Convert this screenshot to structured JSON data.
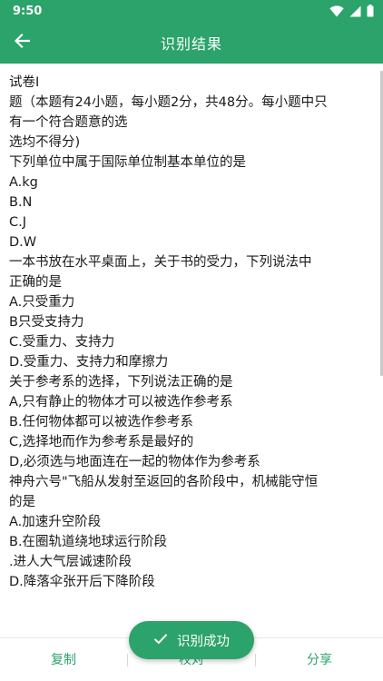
{
  "status_bar": {
    "time": "9:50"
  },
  "app_bar": {
    "title": "识别结果"
  },
  "content": {
    "lines": [
      "试卷I",
      "题（本题有24小题，每小题2分，共48分。每小题中只",
      "有一个符合题意的选",
      "选均不得分)",
      "下列单位中属于国际单位制基本单位的是",
      "A.kg",
      "B.N",
      "C.J",
      "D.W",
      "一本书放在水平桌面上，关于书的受力，下列说法中",
      "正确的是",
      "A.只受重力",
      "B只受支持力",
      "C.受重力、支持力",
      "D.受重力、支持力和摩擦力",
      "关于参考系的选择，下列说法正确的是",
      "A,只有静止的物体才可以被选作参考系",
      "B.任何物体都可以被选作参考系",
      "C,选择地而作为参考系是最好的",
      "D,必须选与地面连在一起的物体作为参考系",
      "神舟六号\"飞船从发射至返回的各阶段中，机械能守恒",
      "的是",
      "A.加速升空阶段",
      "B.在圈轨道绕地球运行阶段",
      ".进人大气层诚速阶段",
      "D.降落伞张开后下降阶段"
    ]
  },
  "bottom_bar": {
    "copy_label": "复制",
    "proofread_label": "校对",
    "share_label": "分享"
  },
  "toast": {
    "message": "识别成功"
  },
  "colors": {
    "brand": "#2ba36a",
    "text": "#1a1a1a",
    "background": "#ffffff"
  },
  "icons": {
    "back": "arrow-left-icon",
    "wifi": "wifi-icon",
    "signal": "signal-icon",
    "battery": "battery-icon",
    "toast": "check-icon"
  }
}
